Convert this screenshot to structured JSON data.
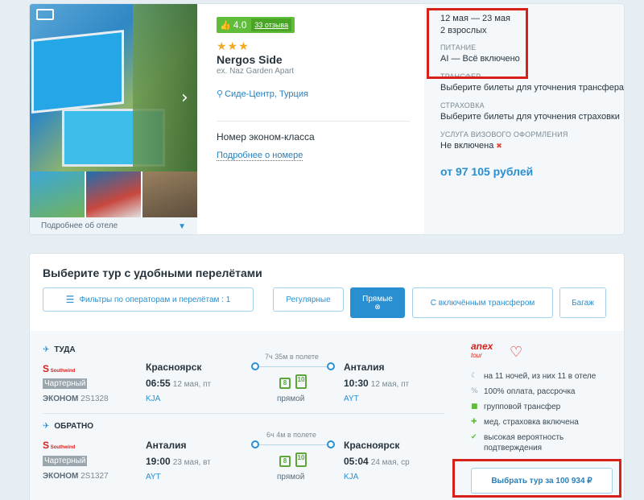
{
  "hotel": {
    "rating": "4.0",
    "reviews": "33 отзыва",
    "stars": "★★★",
    "name": "Nergos Side",
    "ex_name": "ex. Naz Garden Apart",
    "location": "Сиде-Центр, Турция",
    "room": "Номер эконом-класса",
    "room_more": "Подробнее о номере",
    "hotel_more": "Подробнее об отеле"
  },
  "summary": {
    "dates": "12 мая — 23 мая",
    "guests": "2 взрослых",
    "meal_label": "ПИТАНИЕ",
    "meal_value": "AI — Всё включено",
    "transfer_label": "ТРАНСФЕР",
    "transfer_value": "Выберите билеты для уточнения трансфера",
    "insurance_label": "СТРАХОВКА",
    "insurance_value": "Выберите билеты для уточнения страховки",
    "visa_label": "УСЛУГА ВИЗОВОГО ОФОРМЛЕНИЯ",
    "visa_value": "Не включена",
    "price": "от 97 105 рублей"
  },
  "tours": {
    "title": "Выберите тур с удобными перелётами",
    "filter_button": "Фильтры по операторам и перелётам : 1",
    "chip_regular": "Регулярные",
    "chip_direct": "Прямые",
    "chip_transfer": "С включённым трансфером",
    "chip_baggage": "Багаж"
  },
  "outbound": {
    "heading": "ТУДА",
    "airline": "Southwind",
    "type": "Чартерный",
    "fclass": "ЭКОНОМ",
    "flight": "2S1328",
    "from_city": "Красноярск",
    "dep_time": "06:55",
    "dep_date": "12 мая, пт",
    "dep_code": "KJA",
    "duration": "7ч 35м в полете",
    "bag1": "8",
    "bag2": "10",
    "direct": "прямой",
    "to_city": "Анталия",
    "arr_time": "10:30",
    "arr_date": "12 мая, пт",
    "arr_code": "AYT"
  },
  "inbound": {
    "heading": "ОБРАТНО",
    "airline": "Southwind",
    "type": "Чартерный",
    "fclass": "ЭКОНОМ",
    "flight": "2S1327",
    "from_city": "Анталия",
    "dep_time": "19:00",
    "dep_date": "23 мая, вт",
    "dep_code": "AYT",
    "duration": "6ч 4м в полете",
    "bag1": "8",
    "bag2": "10",
    "direct": "прямой",
    "to_city": "Красноярск",
    "arr_time": "05:04",
    "arr_date": "24 мая, ср",
    "arr_code": "KJA"
  },
  "operator": {
    "brand": "anex",
    "brand_sub": "tour",
    "f1": "на 11 ночей, из них 11 в отеле",
    "f2": "100% оплата, рассрочка",
    "f3": "групповой трансфер",
    "f4": "мед. страховка включена",
    "f5": "высокая вероятность подтверждения",
    "choose": "Выбрать тур за 100 934 ₽"
  }
}
